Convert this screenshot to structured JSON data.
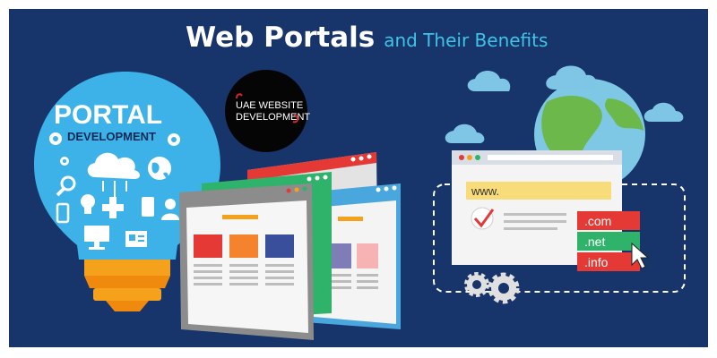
{
  "title": {
    "main": "Web Portals",
    "sub": "and Their Benefits"
  },
  "bulb": {
    "line1": "PORTAL",
    "line2": "DEVELOPMENT"
  },
  "logo": {
    "line1": "UAE WEBSITE",
    "line2": "DEVELOPMENT"
  },
  "browser": {
    "url": "www."
  },
  "domains": [
    ".com",
    ".net",
    ".info"
  ],
  "colors": {
    "background": "#17346b",
    "title_accent": "#3fc3e6",
    "bulb": "#3db2e8",
    "bulb_base": "#f5a11c",
    "domain_red": "#e53935",
    "domain_green": "#2fb36a"
  },
  "icons": [
    "gear-icon",
    "cloud-icon",
    "globe-icon",
    "search-icon",
    "mobile-icon",
    "plus-icon",
    "lightbulb-icon",
    "monitor-icon",
    "user-icon",
    "id-card-icon",
    "checkmark-icon",
    "cursor-icon"
  ]
}
